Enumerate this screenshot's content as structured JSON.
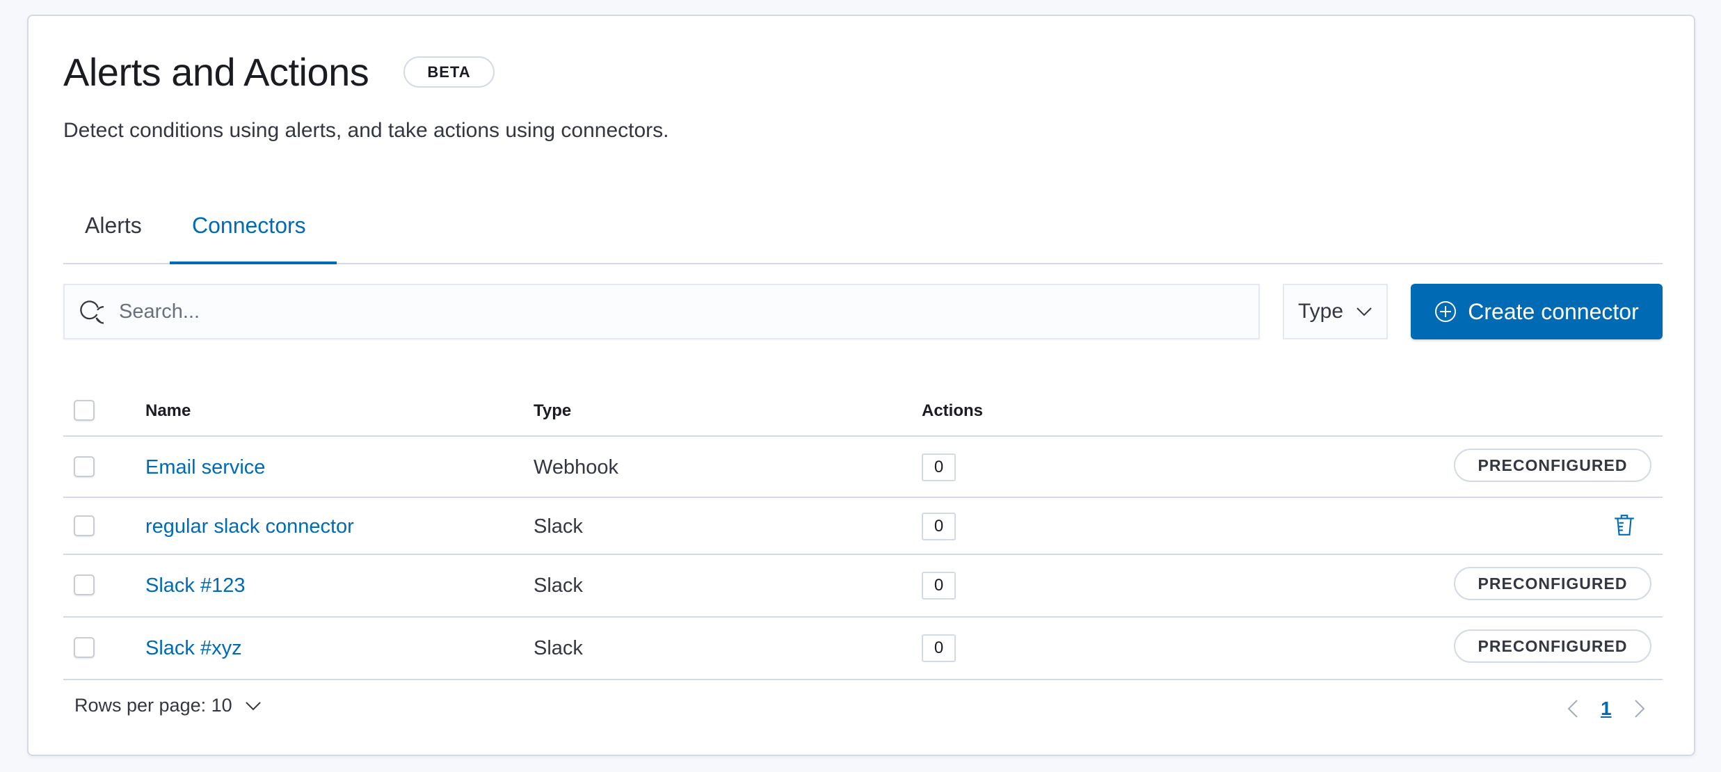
{
  "header": {
    "title": "Alerts and Actions",
    "badge": "BETA",
    "description": "Detect conditions using alerts, and take actions using connectors."
  },
  "tabs": [
    {
      "label": "Alerts",
      "active": false
    },
    {
      "label": "Connectors",
      "active": true
    }
  ],
  "toolbar": {
    "search_placeholder": "Search...",
    "search_value": "",
    "type_filter_label": "Type",
    "create_button_label": "Create connector"
  },
  "table": {
    "columns": [
      "Name",
      "Type",
      "Actions"
    ],
    "rows": [
      {
        "name": "Email service",
        "type": "Webhook",
        "actions": "0",
        "badge": "PRECONFIGURED",
        "deletable": false
      },
      {
        "name": "regular slack connector",
        "type": "Slack",
        "actions": "0",
        "badge": null,
        "deletable": true
      },
      {
        "name": "Slack #123",
        "type": "Slack",
        "actions": "0",
        "badge": "PRECONFIGURED",
        "deletable": false
      },
      {
        "name": "Slack #xyz",
        "type": "Slack",
        "actions": "0",
        "badge": "PRECONFIGURED",
        "deletable": false
      }
    ]
  },
  "pagination": {
    "rows_per_page_label": "Rows per page: 10",
    "current_page": "1"
  },
  "colors": {
    "primary": "#006bb4",
    "border": "#d3dae6",
    "text": "#343741",
    "title": "#1a1c21",
    "background": "#f7f8fc"
  }
}
